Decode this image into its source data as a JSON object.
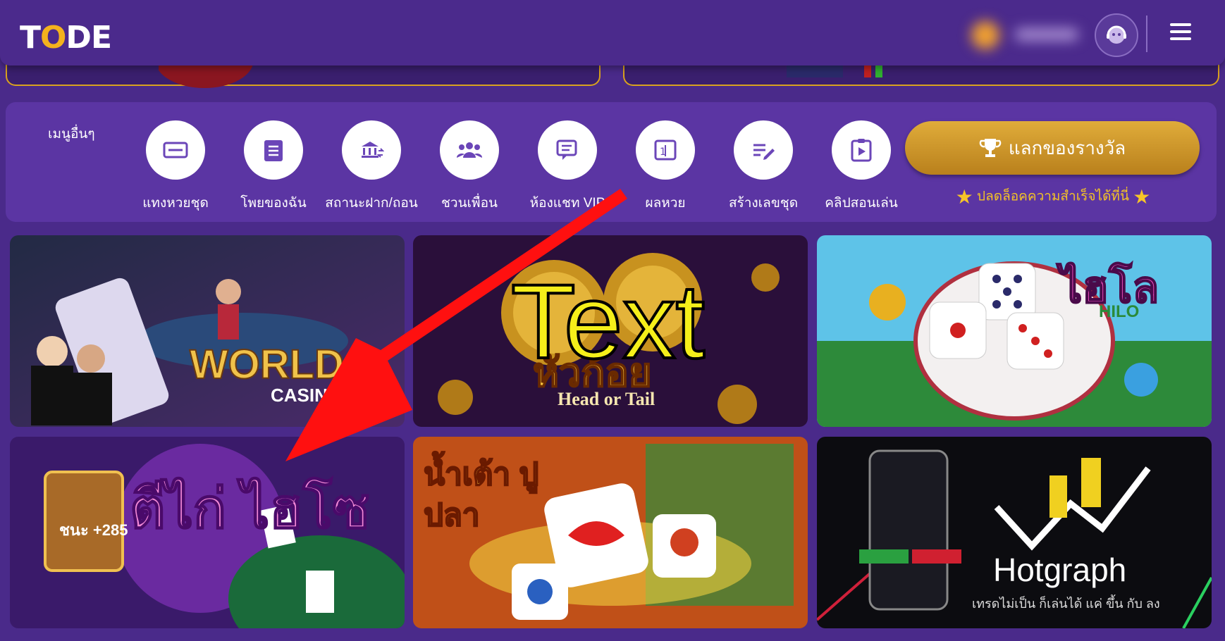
{
  "header": {
    "logo_text": "TODE",
    "support_icon": "support-agent-icon",
    "menu_icon": "hamburger-icon"
  },
  "menu": {
    "section_label": "เมนูอื่นๆ",
    "items": [
      {
        "label": "แทงหวยชุด",
        "icon": "ticket-icon"
      },
      {
        "label": "โพยของฉัน",
        "icon": "checklist-icon"
      },
      {
        "label": "สถานะฝาก/ถอน",
        "icon": "bank-transfer-icon"
      },
      {
        "label": "ชวนเพื่อน",
        "icon": "group-icon"
      },
      {
        "label": "ห้องแชท VIP",
        "icon": "chat-icon"
      },
      {
        "label": "ผลหวย",
        "icon": "lottery-result-icon"
      },
      {
        "label": "สร้างเลขชุด",
        "icon": "edit-list-icon"
      },
      {
        "label": "คลิปสอนเล่น",
        "icon": "video-clip-icon"
      }
    ],
    "reward_button": "แลกของรางวัล",
    "achievement_text": "ปลดล็อคความสำเร็จได้ที่นี่"
  },
  "games": [
    {
      "title": "WORLD",
      "subtitle": "CASINO"
    },
    {
      "title": "หัวก้อย",
      "subtitle": "Head or Tail"
    },
    {
      "title": "ไฮโล",
      "subtitle": "HILO"
    },
    {
      "title": "ตีไก่ ไฮโซ",
      "subtitle": "ชนะ +285"
    },
    {
      "title": "น้ำเต้า ปูปลา",
      "subtitle": ""
    },
    {
      "title": "Hotgraph",
      "subtitle": "เทรดไม่เป็น ก็เล่นได้ แค่ ขึ้น กับ ลง"
    }
  ],
  "annotation": {
    "text": "Text",
    "color": "#f5ef1a",
    "arrow_color": "#ff1010"
  }
}
